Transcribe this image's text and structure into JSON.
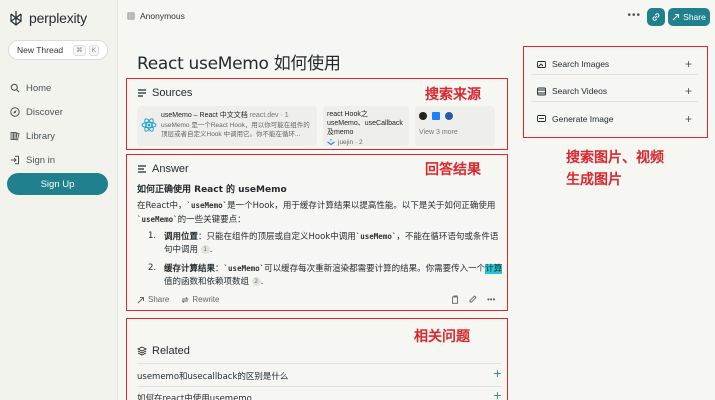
{
  "brand": {
    "name": "perplexity"
  },
  "sidebar": {
    "new_thread": "New Thread",
    "shortcut": [
      "⌘",
      "K"
    ],
    "items": [
      {
        "label": "Home",
        "icon": "search-icon"
      },
      {
        "label": "Discover",
        "icon": "compass-icon"
      },
      {
        "label": "Library",
        "icon": "library-icon"
      },
      {
        "label": "Sign in",
        "icon": "sign-in-icon"
      }
    ],
    "signup": "Sign Up"
  },
  "topbar": {
    "user": "Anonymous",
    "more": "•••",
    "share": "Share"
  },
  "page": {
    "title": "React useMemo 如何使用"
  },
  "sources": {
    "heading": "Sources",
    "annotation": "搜索来源",
    "items": [
      {
        "title": "useMemo – React 中文文档",
        "site": "react.dev · 1",
        "snippet": "useMemo 是一个React Hook，用以你可能在组件的顶层或者自定义Hook 中调用它。你不能在循环..."
      },
      {
        "title": "react Hook之useMemo、useCallback及memo",
        "site": "juejin · 2"
      },
      {
        "more": "View 3 more"
      }
    ]
  },
  "answer": {
    "heading": "Answer",
    "annotation": "回答结果",
    "subheading": "如何正确使用 React 的 useMemo",
    "intro_a": "在React中，",
    "intro_code": "`useMemo`",
    "intro_b": "是一个Hook，用于缓存计算结果以提高性能。以下是关于如何正确使用",
    "intro_code2": "`useMemo`",
    "intro_c": "的一些关键要点：",
    "list": [
      {
        "num": "1.",
        "bold": "调用位置",
        "a": "：只能在组件的顶层或自定义Hook中调用",
        "code": "`useMemo`",
        "b": "，不能在循环语句或条件语句中调用",
        "cite": "1"
      },
      {
        "num": "2.",
        "bold": "缓存计算结果",
        "a": "：",
        "code": "`useMemo`",
        "b": "可以缓存每次重新渲染都需要计算的结果。你需要传入一个",
        "hl": "计算",
        "c": "值的函数和依赖项数组",
        "cite": "2"
      }
    ],
    "actions": {
      "share": "Share",
      "rewrite": "Rewrite"
    }
  },
  "related": {
    "heading": "Related",
    "annotation": "相关问题",
    "items": [
      "usememo和usecallback的区别是什么",
      "如何在react中使用usememo"
    ]
  },
  "right": {
    "annotation_line1": "搜索图片、视频",
    "annotation_line2": "生成图片",
    "buttons": [
      "Search Images",
      "Search Videos",
      "Generate Image"
    ]
  },
  "colors": {
    "accent": "#20808d",
    "annotation_red": "#d9272e"
  }
}
